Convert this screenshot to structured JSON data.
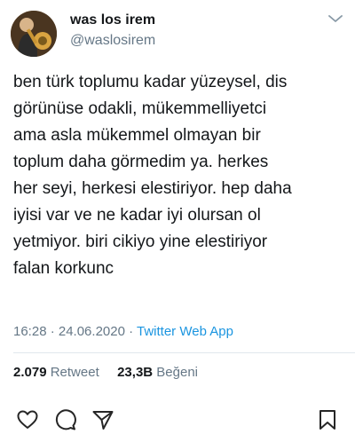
{
  "tweet": {
    "display_name": "was los irem",
    "username": "@waslosirem",
    "text_lines": [
      "ben türk toplumu kadar yüzeysel, dis",
      "görünüse odakli, mükemmelliyetci",
      "ama asla mükemmel olmayan bir",
      "toplum daha görmedim ya. herkes",
      "her seyi, herkesi elestiriyor. hep daha",
      "iyisi var ve ne kadar iyi olursan ol",
      "yetmiyor. biri cikiyo yine elestiriyor",
      "falan korkunc"
    ],
    "timestamp": "16:28 · 24.06.2020 · ",
    "source": "Twitter Web App",
    "retweet_count": "2.079",
    "retweet_label": "Retweet",
    "like_count": "23,3B",
    "like_label": "Beğeni"
  },
  "icons": {
    "menu": "chevron-down-icon",
    "like": "heart-icon",
    "comment": "comment-icon",
    "share": "send-icon",
    "save": "bookmark-icon"
  },
  "colors": {
    "text": "#14171a",
    "secondary": "#657786",
    "link": "#1b95e0",
    "divider": "#e1e8ed"
  }
}
